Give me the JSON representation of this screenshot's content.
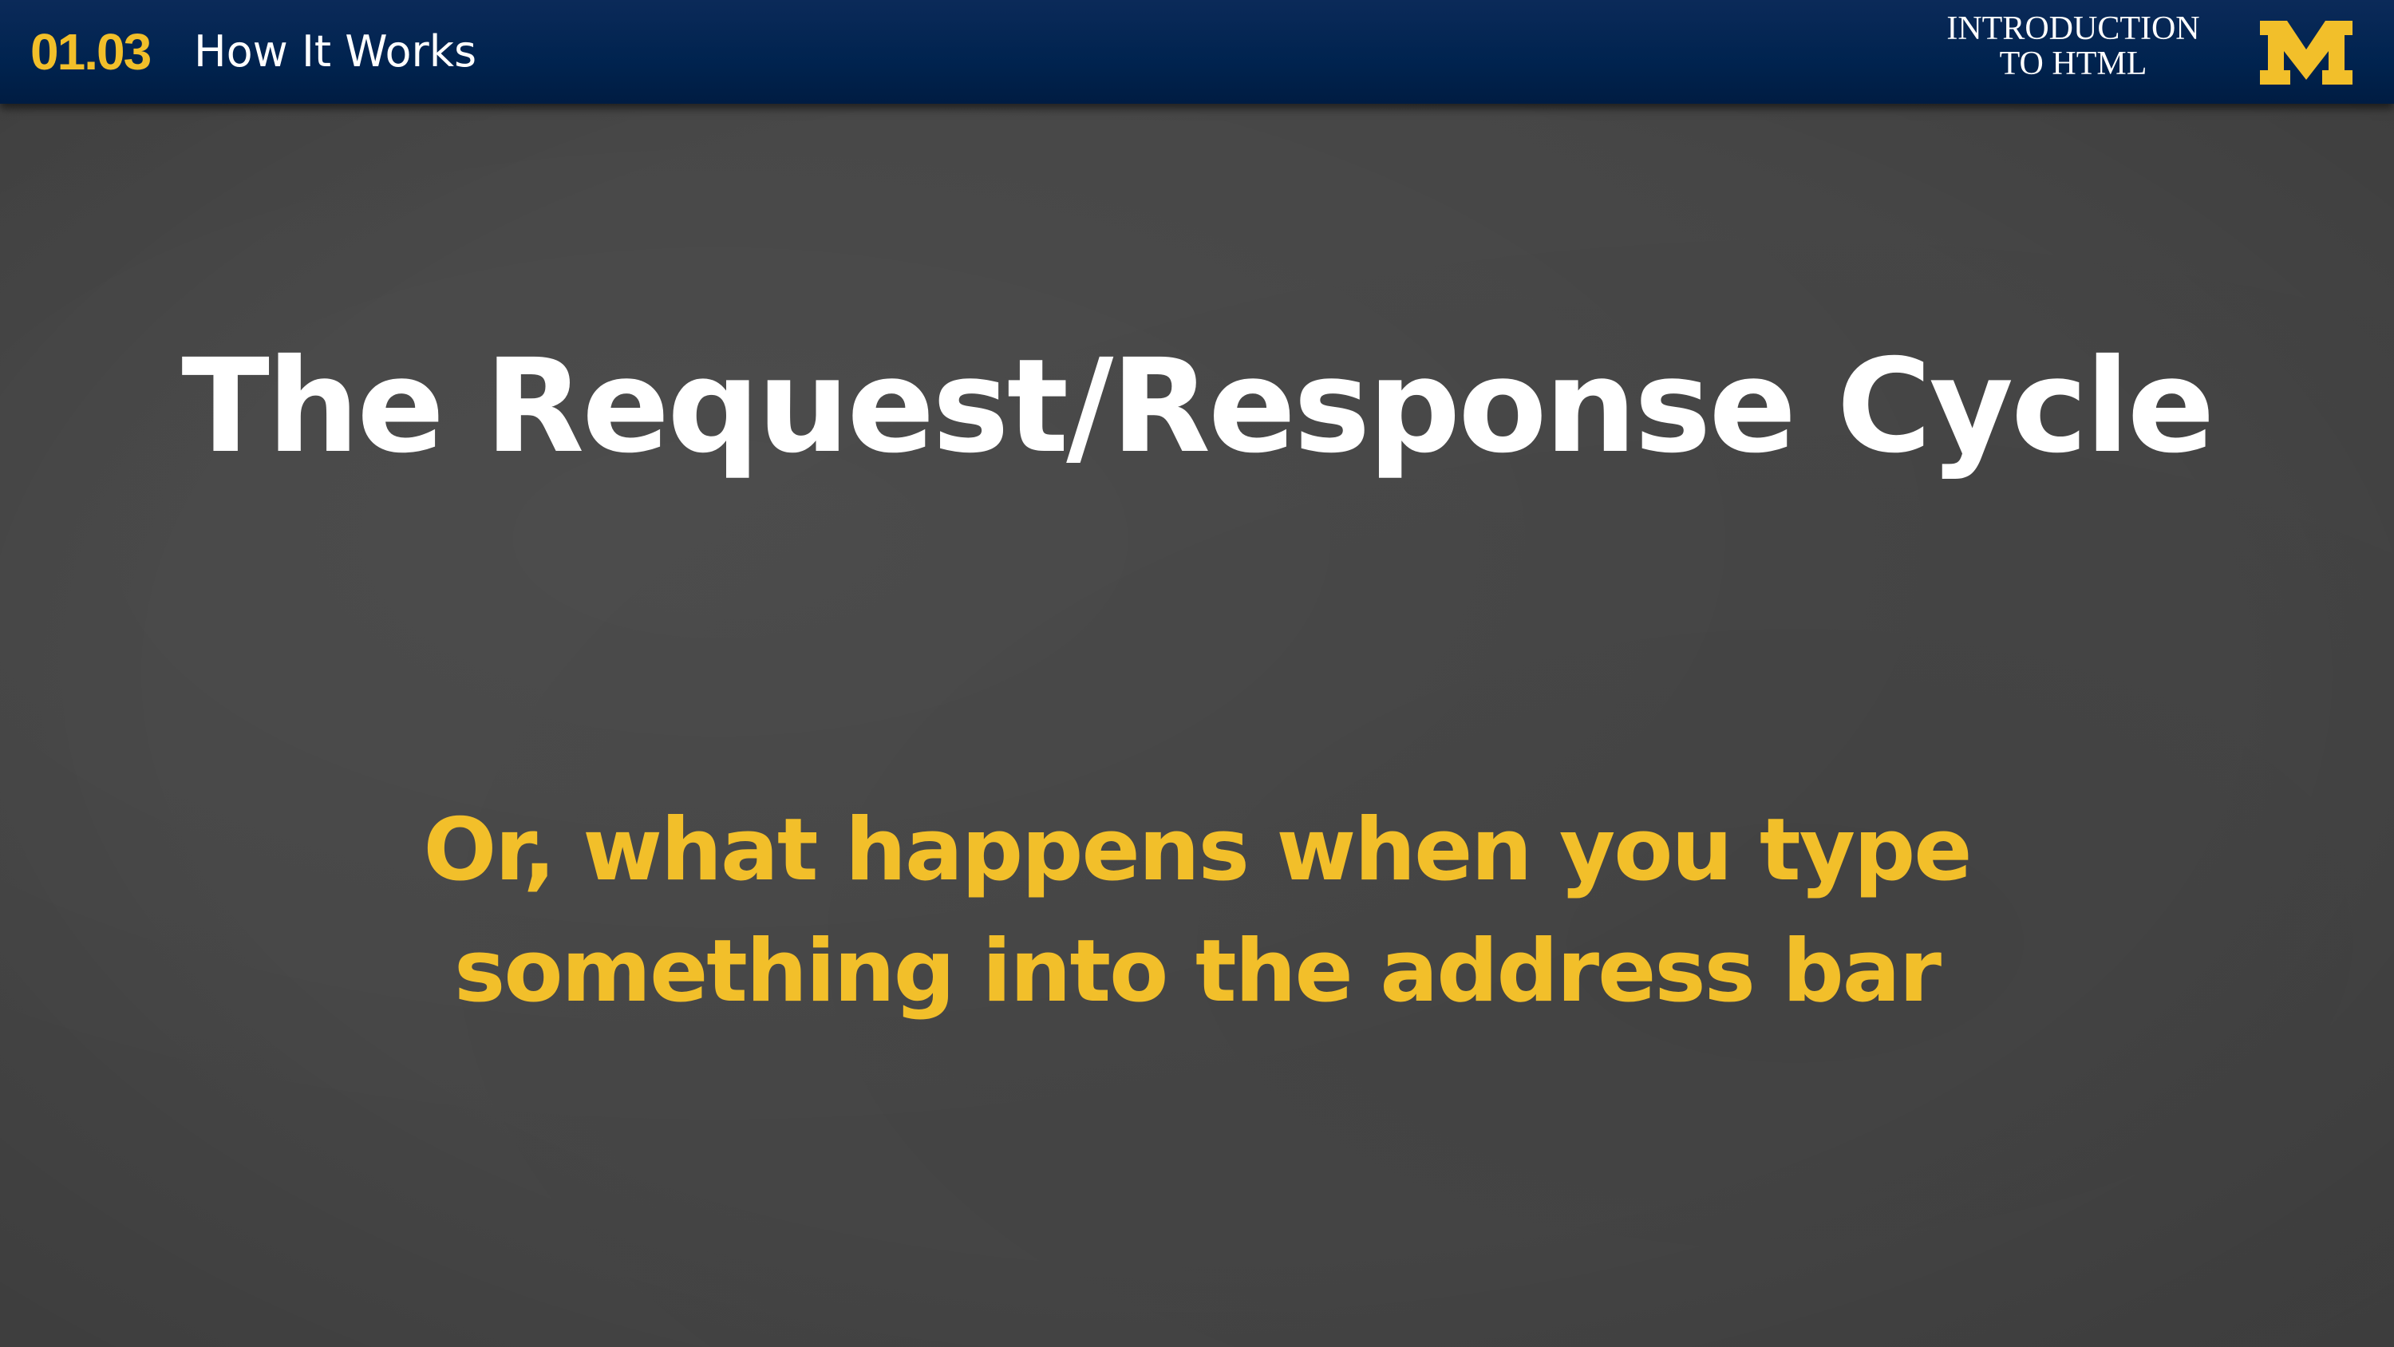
{
  "header": {
    "section_number": "01.03",
    "section_title": "How It Works",
    "course_title_line1": "INTRODUCTION",
    "course_title_line2": "TO HTML",
    "logo_icon": "block-m-logo-icon"
  },
  "slide": {
    "title": "The Request/Response Cycle",
    "subtitle_line1": "Or, what happens when you type",
    "subtitle_line2": "something into the address bar"
  },
  "colors": {
    "header_navy": "#00234f",
    "maize": "#f2bf2a",
    "background": "#464646",
    "title_text": "#ffffff"
  }
}
